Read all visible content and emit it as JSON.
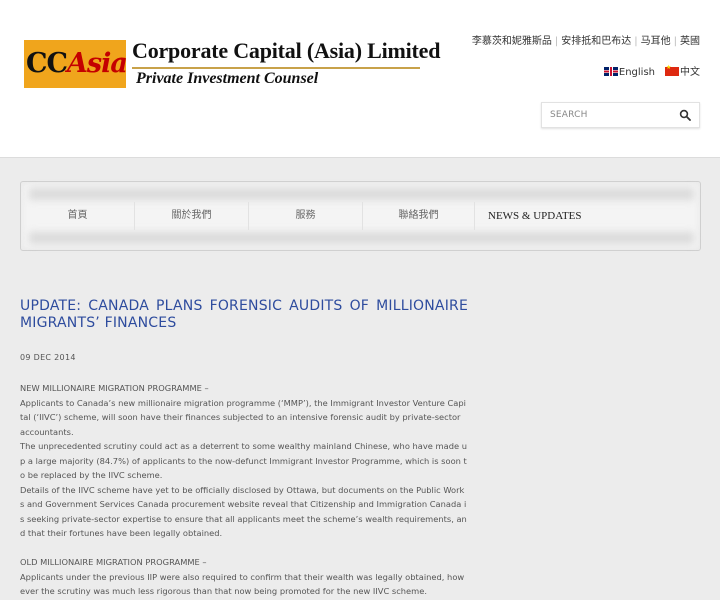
{
  "brand": {
    "mark_cc": "CC",
    "mark_asia": "Asia",
    "title": "Corporate Capital (Asia) Limited",
    "subtitle": "Private Investment Counsel",
    "colors": {
      "logo_box": "#f0a51c",
      "logo_red": "#c40000",
      "rule": "#c8a24a"
    }
  },
  "top_links": [
    "李慕茨和妮雅斯品",
    "安排抵和巴布达",
    "马耳他",
    "英國"
  ],
  "language": {
    "english": "English",
    "chinese": "中文",
    "english_flag": "uk-flag-icon",
    "chinese_flag": "china-flag-icon"
  },
  "search": {
    "placeholder": "SEARCH",
    "icon": "search-icon"
  },
  "nav": {
    "items": [
      "首頁",
      "關於我們",
      "服務",
      "聯絡我們",
      "NEWS & UPDATES"
    ],
    "active": "NEWS & UPDATES"
  },
  "article": {
    "title": "UPDATE: CANADA PLANS FORENSIC AUDITS OF MILLIONAIRE MIGRANTS’ FINANCES",
    "title_color": "#2e4c9e",
    "date": "09 DEC 2014",
    "p1_heading": "NEW MILLIONAIRE MIGRATION PROGRAMME –",
    "p1": "Applicants to Canada’s new millionaire migration programme (‘MMP’), the Immigrant Investor Venture Capital (‘IIVC’) scheme, will soon have their finances subjected to an intensive forensic audit by private-sector accountants.",
    "p2": "The unprecedented scrutiny could act as a deterrent to some wealthy mainland Chinese, who have made up a large majority (84.7%) of applicants to the now-defunct Immigrant Investor Programme, which is soon to be replaced by the IIVC scheme.",
    "p3": "Details of the IIVC scheme have yet to be officially disclosed by Ottawa, but documents on the Public Works and Government Services Canada procurement website reveal that Citizenship and Immigration Canada is seeking private-sector expertise to ensure that all applicants meet the scheme’s wealth requirements, and that their fortunes have been legally obtained.",
    "p4_heading": "OLD MILLIONAIRE MIGRATION PROGRAMME –",
    "p4": "Applicants under the previous IIP were also required to confirm that their wealth was legally obtained, however the scrutiny was much less rigorous than that now being promoted for the new IIVC scheme."
  }
}
